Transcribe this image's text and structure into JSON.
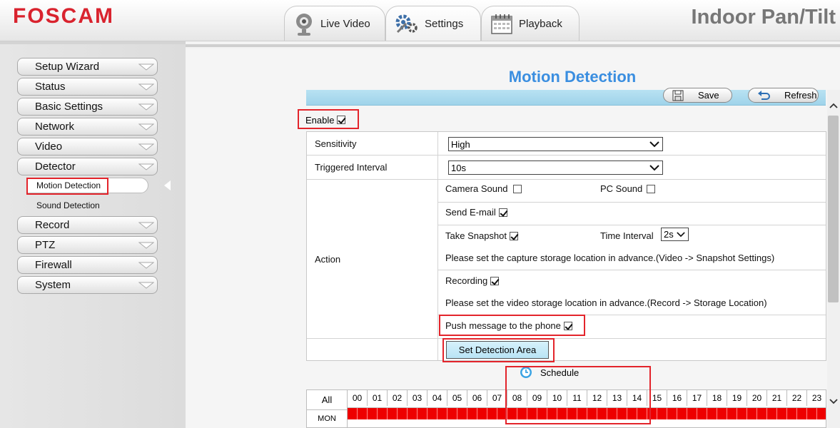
{
  "header": {
    "logo": "FOSCAM",
    "product_name": "Indoor Pan/Tilt",
    "tabs": [
      {
        "label": "Live Video",
        "icon": "webcam-icon"
      },
      {
        "label": "Settings",
        "icon": "gears-icon"
      },
      {
        "label": "Playback",
        "icon": "calendar-icon"
      }
    ]
  },
  "sidebar": {
    "items": [
      {
        "label": "Setup Wizard"
      },
      {
        "label": "Status"
      },
      {
        "label": "Basic Settings"
      },
      {
        "label": "Network"
      },
      {
        "label": "Video"
      },
      {
        "label": "Detector"
      },
      {
        "label": "Record"
      },
      {
        "label": "PTZ"
      },
      {
        "label": "Firewall"
      },
      {
        "label": "System"
      }
    ],
    "detector_sub": [
      {
        "label": "Motion Detection",
        "active": true
      },
      {
        "label": "Sound Detection",
        "active": false
      }
    ]
  },
  "main": {
    "title": "Motion Detection",
    "toolbar": {
      "save_label": "Save",
      "refresh_label": "Refresh"
    },
    "enable": {
      "label": "Enable",
      "checked": true
    },
    "sensitivity": {
      "label": "Sensitivity",
      "value": "High"
    },
    "triggered_interval": {
      "label": "Triggered Interval",
      "value": "10s"
    },
    "action": {
      "label": "Action",
      "camera_sound": {
        "label": "Camera Sound",
        "checked": false
      },
      "pc_sound": {
        "label": "PC Sound",
        "checked": false
      },
      "send_email": {
        "label": "Send E-mail",
        "checked": true
      },
      "take_snapshot": {
        "label": "Take Snapshot",
        "checked": true
      },
      "time_interval": {
        "label": "Time Interval",
        "value": "2s"
      },
      "snapshot_note": "Please set the capture storage location in advance.(Video -> Snapshot Settings)",
      "recording": {
        "label": "Recording",
        "checked": true
      },
      "recording_note": "Please set the video storage location in advance.(Record -> Storage Location)",
      "push_message": {
        "label": "Push message to the phone",
        "checked": true
      }
    },
    "set_detection_area_label": "Set Detection Area",
    "schedule": {
      "title": "Schedule",
      "all_label": "All",
      "hours": [
        "00",
        "01",
        "02",
        "03",
        "04",
        "05",
        "06",
        "07",
        "08",
        "09",
        "10",
        "11",
        "12",
        "13",
        "14",
        "15",
        "16",
        "17",
        "18",
        "19",
        "20",
        "21",
        "22",
        "23"
      ],
      "days": [
        "MON"
      ],
      "slot_color": "#ee0000"
    }
  },
  "colors": {
    "accent": "#3a8ee0",
    "brand_red": "#d9232e",
    "highlight_box": "#e3242b"
  }
}
